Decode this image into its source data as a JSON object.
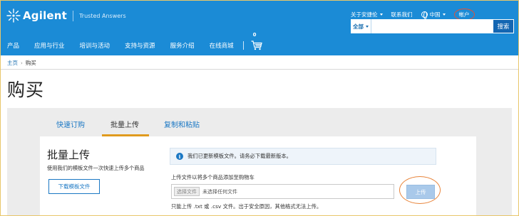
{
  "header": {
    "logo_text": "Agilent",
    "tagline": "Trusted Answers",
    "util_links": {
      "about": "关于安捷伦",
      "contact": "联系我们",
      "region": "中国",
      "account": "帐户"
    },
    "search": {
      "scope": "全部",
      "placeholder": "",
      "button": "搜索"
    },
    "nav": [
      "产品",
      "应用与行业",
      "培训与活动",
      "支持与资源",
      "服务介绍",
      "在线商城"
    ],
    "cart_count": "0",
    "brand_color": "#1b8bd6"
  },
  "breadcrumb": {
    "home": "主页",
    "current": "购买"
  },
  "page_title": "购买",
  "tabs": [
    {
      "label": "快速订购",
      "active": false
    },
    {
      "label": "批量上传",
      "active": true
    },
    {
      "label": "复制和粘贴",
      "active": false
    }
  ],
  "bulk_upload": {
    "title": "批量上传",
    "description": "使用我们的模板文件一次快速上传多个商品",
    "download_button": "下载模板文件",
    "info_message": "我们已更新模板文件。请务必下载最新版本。",
    "upload_label": "上传文件以将多个商品添加至购物车",
    "choose_file_button": "选择文件",
    "no_file_text": "未选择任何文件",
    "upload_button": "上传",
    "format_note": "只能上传 .txt 或 .csv 文件。出于安全原因，其他格式无法上传。"
  },
  "icons": {
    "logo": "agilent-spark-icon",
    "globe": "globe-icon",
    "cart": "cart-icon",
    "info": "info-icon"
  }
}
